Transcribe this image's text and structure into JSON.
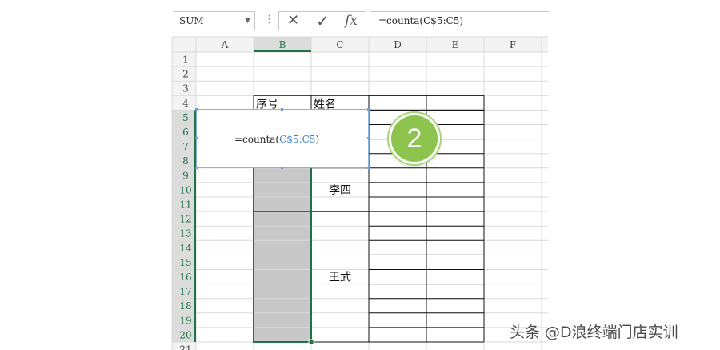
{
  "name_box": {
    "value": "SUM"
  },
  "formula_bar": {
    "cancel_symbol": "✕",
    "enter_symbol": "✓",
    "fx_label": "fx",
    "formula": "=counta(C$5:C5)"
  },
  "columns": [
    "A",
    "B",
    "C",
    "D",
    "E",
    "F"
  ],
  "rows": [
    "1",
    "2",
    "3",
    "4",
    "5",
    "6",
    "7",
    "8",
    "9",
    "10",
    "11",
    "12",
    "13",
    "14",
    "15",
    "16",
    "17",
    "18",
    "19",
    "20",
    "21"
  ],
  "table": {
    "header_serial": "序号",
    "header_name": "姓名",
    "names": [
      "李四",
      "王武"
    ]
  },
  "cell_editor": {
    "func": "=counta(",
    "ref": "C$5:C5",
    "close": ")"
  },
  "step_badge": "2",
  "watermark": "头条 @D浪终端门店实训",
  "colors": {
    "selection": "#217346",
    "merged_fill": "#c8c8c8",
    "reference": "#3c7fd0",
    "badge": "#8cc44d"
  }
}
